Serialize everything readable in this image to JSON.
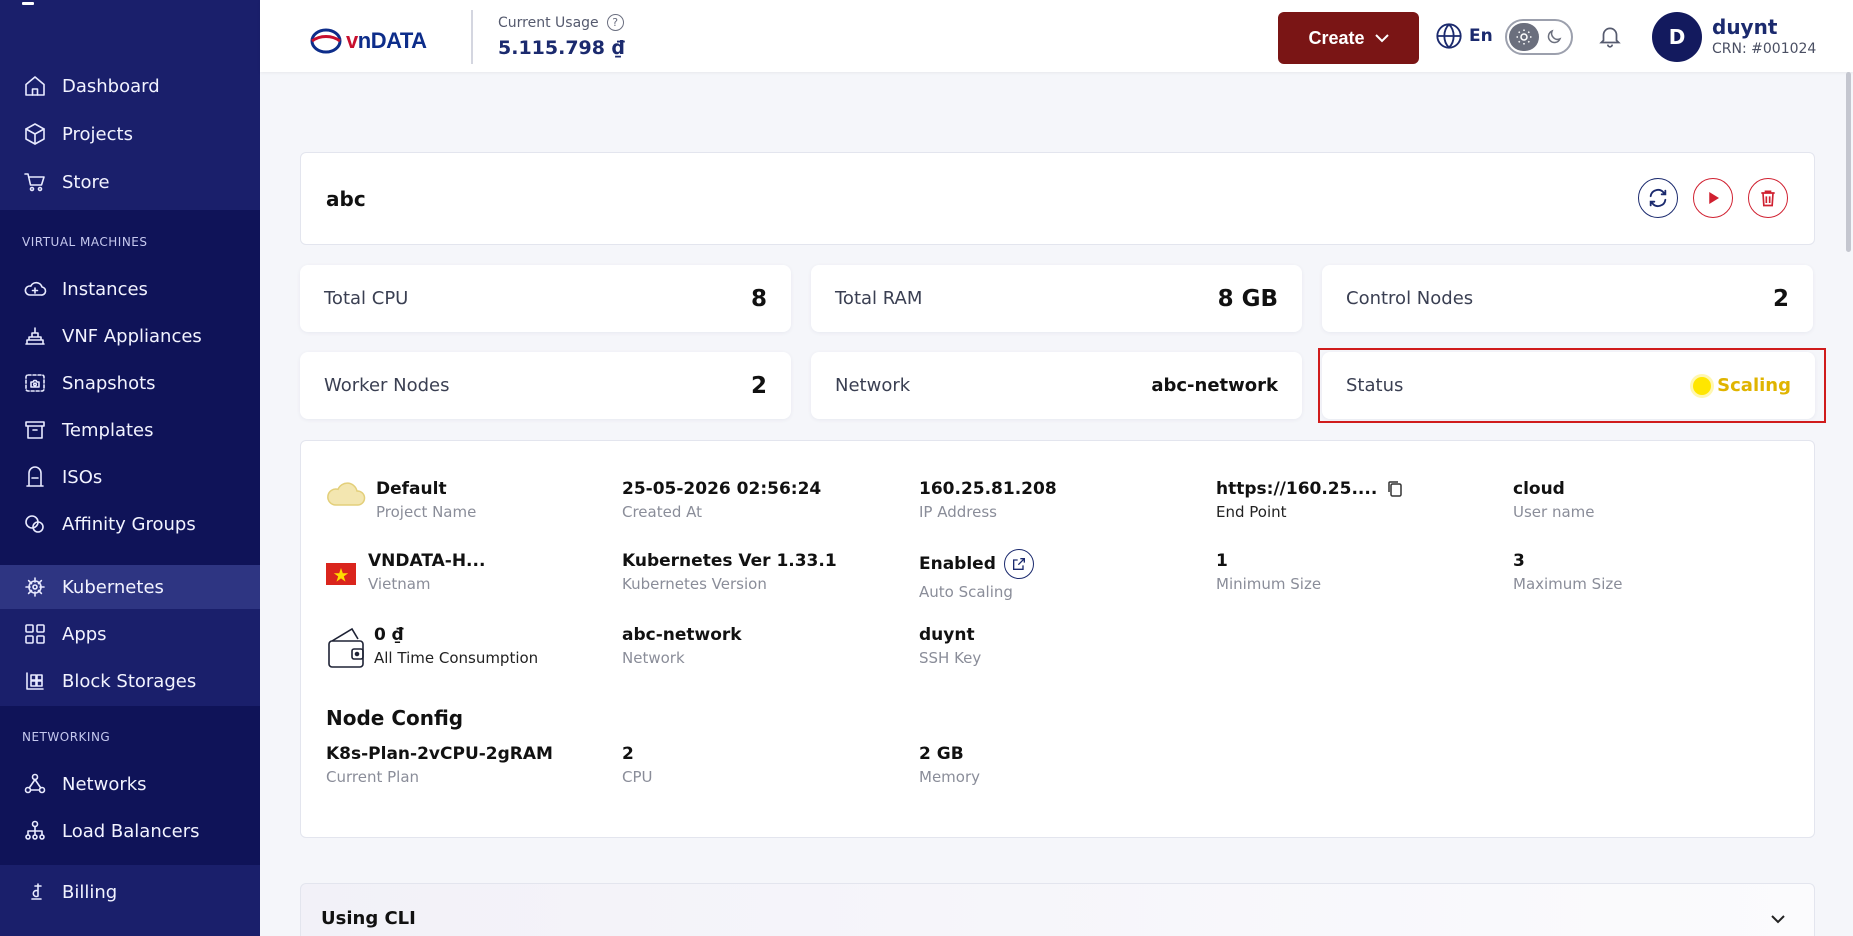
{
  "sidebar": {
    "items": [
      {
        "label": "Dashboard"
      },
      {
        "label": "Projects"
      },
      {
        "label": "Store"
      },
      {
        "label": "Instances"
      },
      {
        "label": "VNF Appliances"
      },
      {
        "label": "Snapshots"
      },
      {
        "label": "Templates"
      },
      {
        "label": "ISOs"
      },
      {
        "label": "Affinity Groups"
      },
      {
        "label": "Kubernetes"
      },
      {
        "label": "Apps"
      },
      {
        "label": "Block Storages"
      },
      {
        "label": "Networks"
      },
      {
        "label": "Load Balancers"
      },
      {
        "label": "Billing"
      }
    ],
    "sections": {
      "virtual_machines": "VIRTUAL MACHINES",
      "networking": "NETWORKING"
    }
  },
  "header": {
    "logo_v": "v",
    "logo_text": "nDATA",
    "usage_label": "Current Usage",
    "usage_help": "?",
    "usage_value": "5.115.798 ₫",
    "create_label": "Create",
    "lang": "En",
    "user_initial": "D",
    "user_name": "duynt",
    "user_crn": "CRN: #001024"
  },
  "cluster": {
    "name": "abc"
  },
  "stats": {
    "total_cpu_label": "Total CPU",
    "total_cpu": "8",
    "total_ram_label": "Total RAM",
    "total_ram": "8 GB",
    "control_nodes_label": "Control Nodes",
    "control_nodes": "2",
    "worker_nodes_label": "Worker Nodes",
    "worker_nodes": "2",
    "network_label": "Network",
    "network": "abc-network",
    "status_label": "Status",
    "status": "Scaling"
  },
  "details": {
    "project_name": "Default",
    "project_name_label": "Project Name",
    "created_at": "25-05-2026 02:56:24",
    "created_at_label": "Created At",
    "ip_address": "160.25.81.208",
    "ip_address_label": "IP Address",
    "end_point": "https://160.25....",
    "end_point_label": "End Point",
    "user_name": "cloud",
    "user_name_label": "User name",
    "zone": "VNDATA-H...",
    "zone_label": "Vietnam",
    "k8s_version": "Kubernetes Ver 1.33.1",
    "k8s_version_label": "Kubernetes Version",
    "auto_scaling": "Enabled",
    "auto_scaling_label": "Auto Scaling",
    "min_size": "1",
    "min_size_label": "Minimum Size",
    "max_size": "3",
    "max_size_label": "Maximum Size",
    "consumption": "0 ₫",
    "consumption_label": "All Time Consumption",
    "network": "abc-network",
    "network_label": "Network",
    "ssh_key": "duynt",
    "ssh_key_label": "SSH Key"
  },
  "node_config": {
    "title": "Node Config",
    "plan": "K8s-Plan-2vCPU-2gRAM",
    "plan_label": "Current Plan",
    "cpu": "2",
    "cpu_label": "CPU",
    "memory": "2 GB",
    "memory_label": "Memory"
  },
  "cli": {
    "title": "Using CLI"
  },
  "colors": {
    "sidebar": "#1a1f6b",
    "create": "#7a1515",
    "status": "#e0b400",
    "highlight": "#d01c1c"
  }
}
